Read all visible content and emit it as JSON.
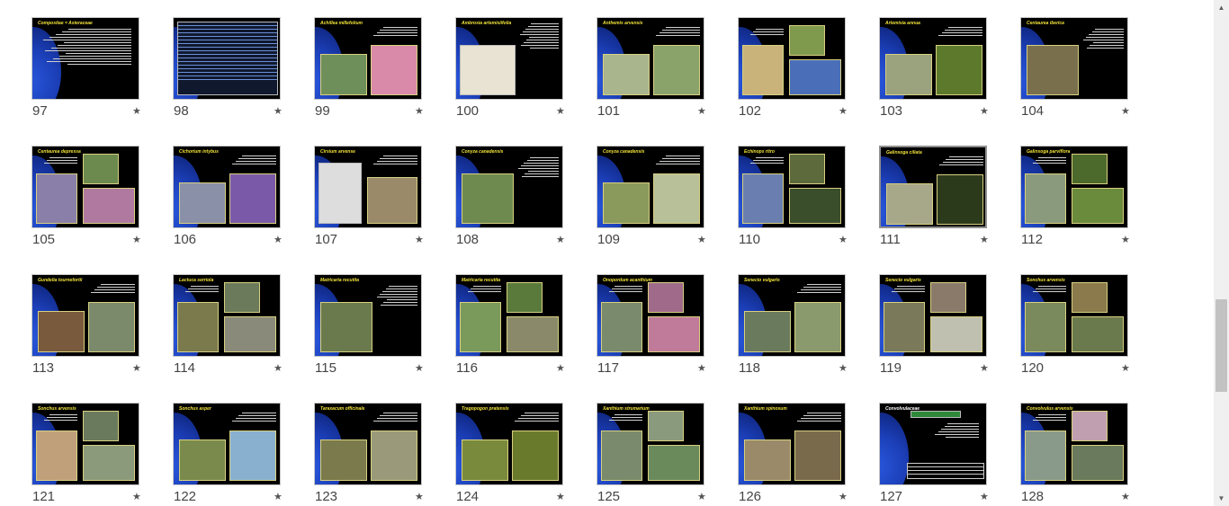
{
  "slides": [
    {
      "number": "97",
      "title": "Compositae = Asteraceae",
      "layout": "text",
      "title_color": "#f2e33a"
    },
    {
      "number": "98",
      "title": "",
      "layout": "table",
      "title_color": "#ffffff"
    },
    {
      "number": "99",
      "title": "Achillea millefolium",
      "layout": "two",
      "title_color": "#f2e33a",
      "p1": "#6f8f5a",
      "p2": "#d98aa8"
    },
    {
      "number": "100",
      "title": "Ambrosia artemisiifolia",
      "layout": "one-light",
      "title_color": "#f2e33a",
      "p1": "#e8e3d2"
    },
    {
      "number": "101",
      "title": "Anthemis arvensis",
      "layout": "two",
      "title_color": "#f2e33a",
      "p1": "#a9b58d",
      "p2": "#8aa36a"
    },
    {
      "number": "102",
      "title": "",
      "layout": "three",
      "title_color": "#f2e33a",
      "p1": "#c9b37a",
      "p2": "#7f9a4c",
      "p3": "#4a6fb8"
    },
    {
      "number": "103",
      "title": "Artemisia annua",
      "layout": "two",
      "title_color": "#f2e33a",
      "p1": "#9aa37e",
      "p2": "#5d7a2c"
    },
    {
      "number": "104",
      "title": "Centaurea iberica",
      "layout": "one",
      "title_color": "#f2e33a",
      "p1": "#7a6f4d"
    },
    {
      "number": "105",
      "title": "Centaurea depressa",
      "layout": "three",
      "title_color": "#f2e33a",
      "p1": "#8a7fa8",
      "p2": "#6c8a4e",
      "p3": "#b07aa0"
    },
    {
      "number": "106",
      "title": "Cichorium intybus",
      "layout": "two",
      "title_color": "#f2e33a",
      "p1": "#8a90a8",
      "p2": "#7a5aa8"
    },
    {
      "number": "107",
      "title": "Cirsium arvense",
      "layout": "two-light",
      "title_color": "#f2e33a",
      "p1": "#dddddd",
      "p2": "#9a8a6a"
    },
    {
      "number": "108",
      "title": "Conyza canadensis",
      "layout": "one",
      "title_color": "#f2e33a",
      "p1": "#6f8a4e"
    },
    {
      "number": "109",
      "title": "Conyza canadensis",
      "layout": "two",
      "title_color": "#f2e33a",
      "p1": "#8a9a5c",
      "p2": "#b8c09a"
    },
    {
      "number": "110",
      "title": "Echinops ritro",
      "layout": "three",
      "title_color": "#f2e33a",
      "p1": "#6a7fb0",
      "p2": "#5c6a3c",
      "p3": "#3a4e2c"
    },
    {
      "number": "111",
      "title": "Galinsoga ciliata",
      "layout": "two",
      "title_color": "#f2e33a",
      "p1": "#a7a78a",
      "p2": "#2c3a1c",
      "selected": true
    },
    {
      "number": "112",
      "title": "Galinsoga parviflora",
      "layout": "three",
      "title_color": "#f2e33a",
      "p1": "#8a9a7c",
      "p2": "#4c6a2c",
      "p3": "#6a8a3c"
    },
    {
      "number": "113",
      "title": "Gundelia tournefortii",
      "layout": "two",
      "title_color": "#f2e33a",
      "p1": "#7a5a3c",
      "p2": "#7a8a6a"
    },
    {
      "number": "114",
      "title": "Lactuca serriola",
      "layout": "three",
      "title_color": "#f2e33a",
      "p1": "#7a7a4c",
      "p2": "#6a7a5a",
      "p3": "#8a8a7a"
    },
    {
      "number": "115",
      "title": "Matricaria recutita",
      "layout": "one",
      "title_color": "#f2e33a",
      "p1": "#6a7a4c"
    },
    {
      "number": "116",
      "title": "Matricaria recutita",
      "layout": "three",
      "title_color": "#f2e33a",
      "p1": "#7a9a5c",
      "p2": "#5a7a3c",
      "p3": "#8a8a6a"
    },
    {
      "number": "117",
      "title": "Onopordum acanthium",
      "layout": "three",
      "title_color": "#f2e33a",
      "p1": "#7a8a6c",
      "p2": "#a06a8a",
      "p3": "#c07a9a"
    },
    {
      "number": "118",
      "title": "Senecio vulgaris",
      "layout": "two",
      "title_color": "#f2e33a",
      "p1": "#6a7a5c",
      "p2": "#8a9a6c"
    },
    {
      "number": "119",
      "title": "Senecio vulgaris",
      "layout": "three",
      "title_color": "#f2e33a",
      "p1": "#7a7a5a",
      "p2": "#8a7a6a",
      "p3": "#c0c0b0"
    },
    {
      "number": "120",
      "title": "Sonchus arvensis",
      "layout": "three",
      "title_color": "#f2e33a",
      "p1": "#7a8a5c",
      "p2": "#8a7a4c",
      "p3": "#6a7a4c"
    },
    {
      "number": "121",
      "title": "Sonchus arvensis",
      "layout": "three",
      "title_color": "#f2e33a",
      "p1": "#c0a07a",
      "p2": "#6a7a5c",
      "p3": "#8a9a7a"
    },
    {
      "number": "122",
      "title": "Sonchus asper",
      "layout": "two",
      "title_color": "#f2e33a",
      "p1": "#7a8a4c",
      "p2": "#8ab0d0"
    },
    {
      "number": "123",
      "title": "Taraxacum officinale",
      "layout": "two",
      "title_color": "#f2e33a",
      "p1": "#7a7a4c",
      "p2": "#9a9a7a"
    },
    {
      "number": "124",
      "title": "Tragopogon pratensis",
      "layout": "two",
      "title_color": "#f2e33a",
      "p1": "#7a8a3c",
      "p2": "#6a7a2c"
    },
    {
      "number": "125",
      "title": "Xanthium strumarium",
      "layout": "three",
      "title_color": "#f2e33a",
      "p1": "#7a8a6c",
      "p2": "#8a9a7c",
      "p3": "#6a8a5c"
    },
    {
      "number": "126",
      "title": "Xanthium spinosum",
      "layout": "two",
      "title_color": "#f2e33a",
      "p1": "#9a8a6a",
      "p2": "#7a6a4c"
    },
    {
      "number": "127",
      "title": "Convolvulaceae",
      "layout": "table-dark",
      "title_color": "#ffffff"
    },
    {
      "number": "128",
      "title": "Convolvulus arvensis",
      "layout": "three",
      "title_color": "#f2e33a",
      "p1": "#8a9a8a",
      "p2": "#c0a0b0",
      "p3": "#6a7a5c"
    }
  ],
  "star_glyph": "★",
  "scrollbar": {
    "up_icon": "▲",
    "down_icon": "▼"
  }
}
